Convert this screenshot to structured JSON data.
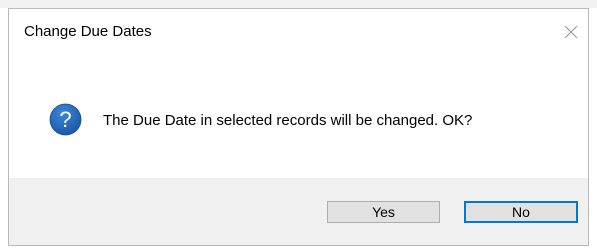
{
  "dialog": {
    "title": "Change Due Dates",
    "message": "The Due Date in selected records will be changed. OK?",
    "icon": "question-icon",
    "close_icon": "close-icon",
    "buttons": {
      "yes_label": "Yes",
      "no_label": "No",
      "default": "No"
    },
    "colors": {
      "icon_blue": "#1e5fb3",
      "focus_border": "#0078d7",
      "footer_bg": "#f0f0f0"
    }
  }
}
